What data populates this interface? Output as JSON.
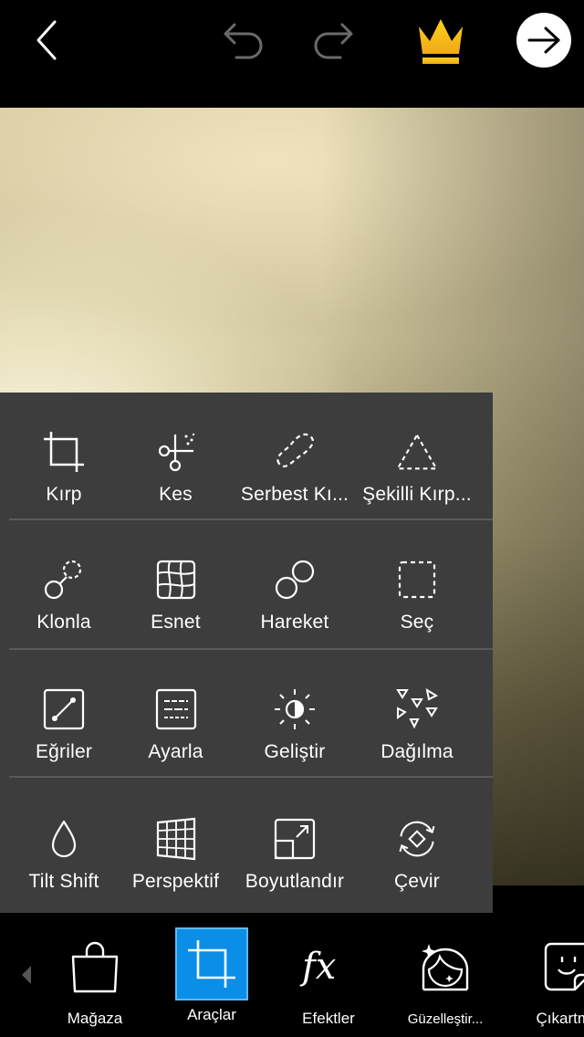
{
  "toolbar": {
    "back_icon": "chevron-left-icon",
    "undo_icon": "undo-icon",
    "redo_icon": "redo-icon",
    "premium_icon": "crown-icon",
    "premium_color": "#f5c518",
    "next_icon": "arrow-right-icon"
  },
  "tools_panel": {
    "background": "#3d3d3d",
    "rows": [
      [
        {
          "label": "Kırp",
          "icon": "crop-icon"
        },
        {
          "label": "Kes",
          "icon": "scissors-icon"
        },
        {
          "label": "Serbest Kı...",
          "icon": "free-crop-icon"
        },
        {
          "label": "Şekilli Kırp...",
          "icon": "shape-crop-icon"
        }
      ],
      [
        {
          "label": "Klonla",
          "icon": "clone-icon"
        },
        {
          "label": "Esnet",
          "icon": "stretch-icon"
        },
        {
          "label": "Hareket",
          "icon": "motion-icon"
        },
        {
          "label": "Seç",
          "icon": "select-icon"
        }
      ],
      [
        {
          "label": "Eğriler",
          "icon": "curves-icon"
        },
        {
          "label": "Ayarla",
          "icon": "adjust-icon"
        },
        {
          "label": "Geliştir",
          "icon": "enhance-icon"
        },
        {
          "label": "Dağılma",
          "icon": "dispersion-icon"
        }
      ],
      [
        {
          "label": "Tilt Shift",
          "icon": "tilt-shift-icon"
        },
        {
          "label": "Perspektif",
          "icon": "perspective-icon"
        },
        {
          "label": "Boyutlandır",
          "icon": "resize-icon"
        },
        {
          "label": "Çevir",
          "icon": "rotate-icon"
        }
      ]
    ]
  },
  "bottom_nav": {
    "active_color": "#0b8ee8",
    "items": [
      {
        "label": "Mağaza",
        "icon": "shopping-bag-icon"
      },
      {
        "label": "Araçlar",
        "icon": "crop-icon",
        "active": true
      },
      {
        "label": "Efektler",
        "icon": "fx-icon"
      },
      {
        "label": "Güzelleştir...",
        "icon": "face-beautify-icon"
      },
      {
        "label": "Çıkartma",
        "icon": "sticker-icon"
      }
    ]
  }
}
